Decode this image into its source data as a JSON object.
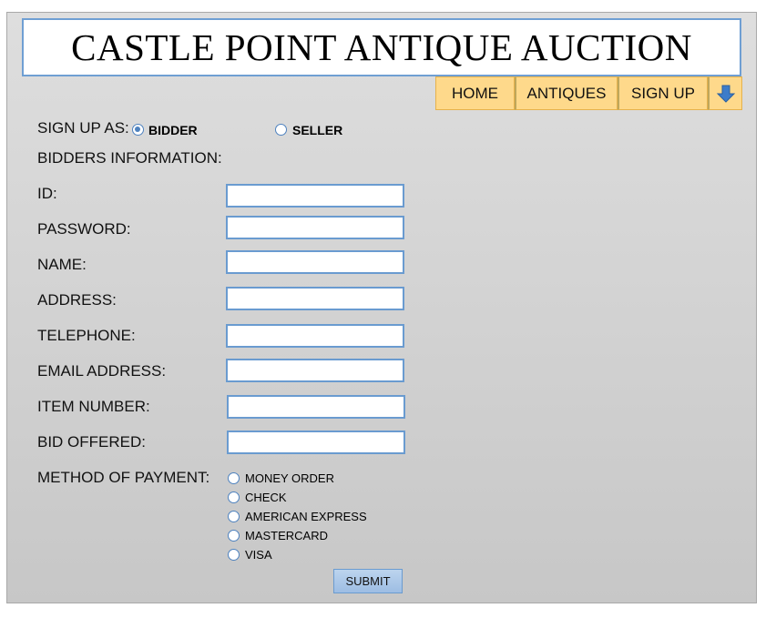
{
  "header": {
    "title": "CASTLE POINT ANTIQUE AUCTION"
  },
  "nav": {
    "home": "HOME",
    "antiques": "ANTIQUES",
    "signup": "SIGN UP",
    "arrow_icon": "down-arrow-icon"
  },
  "signup_as": {
    "label": "SIGN UP AS:",
    "options": [
      {
        "label": "BIDDER",
        "selected": true
      },
      {
        "label": "SELLER",
        "selected": false
      }
    ]
  },
  "section_title": "BIDDERS INFORMATION:",
  "fields": [
    {
      "label": "ID:",
      "value": ""
    },
    {
      "label": "PASSWORD:",
      "value": ""
    },
    {
      "label": "NAME:",
      "value": ""
    },
    {
      "label": "ADDRESS:",
      "value": ""
    },
    {
      "label": "TELEPHONE:",
      "value": ""
    },
    {
      "label": "EMAIL ADDRESS:",
      "value": ""
    },
    {
      "label": "ITEM NUMBER:",
      "value": ""
    },
    {
      "label": "BID OFFERED:",
      "value": ""
    }
  ],
  "payment": {
    "label": "METHOD OF PAYMENT:",
    "options": [
      "MONEY ORDER",
      "CHECK",
      "AMERICAN EXPRESS",
      "MASTERCARD",
      "VISA"
    ]
  },
  "submit_label": "SUBMIT",
  "colors": {
    "accent_blue": "#6a9bd0",
    "nav_bg": "#fed98b",
    "panel_bg": "#cfcfcf"
  }
}
